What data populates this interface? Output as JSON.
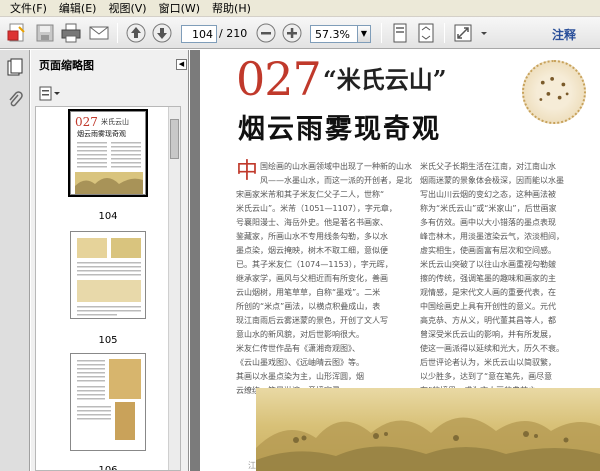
{
  "menu": [
    "文件(F)",
    "编辑(E)",
    "视图(V)",
    "窗口(W)",
    "帮助(H)"
  ],
  "toolbar": {
    "page_current": "104",
    "page_total": "/ 210",
    "zoom": "57.3%",
    "annotate_label": "注释"
  },
  "panel": {
    "title": "页面缩略图",
    "thumbnails": [
      {
        "label": "104"
      },
      {
        "label": "105"
      },
      {
        "label": "106"
      }
    ]
  },
  "document": {
    "chapter_number": "027",
    "title_quoted": "“米氏云山”",
    "subtitle": "烟云雨雾现奇观",
    "drop_cap": "中",
    "col1": [
      "  国绘画的山水画领域中出现了一种新的山水画",
      "  风——水墨山水，而这一派的开创者，是北",
      "宋画家米芾和其子米友仁父子二人，世称“",
      "  米氏云山”。米芾（1051—1107），字元章，",
      "号襄阳漫士、海岳外史。他是著名书画家、",
      "鉴藏家，所画山水不专用线条勾勒，多以水",
      "墨点染，烟云掩映，树木不取工细，意似便",
      "已。其子米友仁（1074—1153），字元晖，",
      "继承家学，画风与父相近而有所变化，善画",
      "云山烟树，用笔草草，自称“墨戏”。二米",
      "所创的“米点”画法，以横点积叠成山，表",
      "现江南雨后云雾迷蒙的景色，开创了文人写",
      "意山水的新风貌，对后世影响很大。",
      "  米友仁传世作品有《潇湘奇观图》、",
      "《云山墨戏图》、《远岫晴云图》等。",
      "其画以水墨点染为主，山形浑圆，烟",
      "云缭绕，笔墨淋漓，意境空灵。"
    ],
    "col2": [
      "米氏父子长期生活在江南，对江南山水",
      "烟雨迷蒙的景象体会极深，因而能以水墨",
      "写出山川云烟的变幻之态，这种画法被",
      "称为“米氏云山”或“米家山”，后世画家",
      "多有仿效。画中以大小错落的墨点表现",
      "峰峦林木，用淡墨渲染云气，浓淡相间，",
      "虚实相生，使画面富有层次和空间感。",
      "米氏云山突破了以往山水画重视勾勒皴",
      "擦的传统，强调笔墨的趣味和画家的主",
      "观情感，是宋代文人画的重要代表，在",
      "中国绘画史上具有开创性的意义。元代",
      "高克恭、方从义，明代董其昌等人，都",
      "曾深受米氏云山的影响，并有所发展，",
      "使这一画派得以延续和光大，历久不衰。",
      "后世评论者认为，米氏云山以简驭繁，",
      "以少胜多，达到了“意在笔先，画尽意",
      "在”的境界，成为文人画的典范之一。"
    ],
    "footer_mark": "江"
  }
}
